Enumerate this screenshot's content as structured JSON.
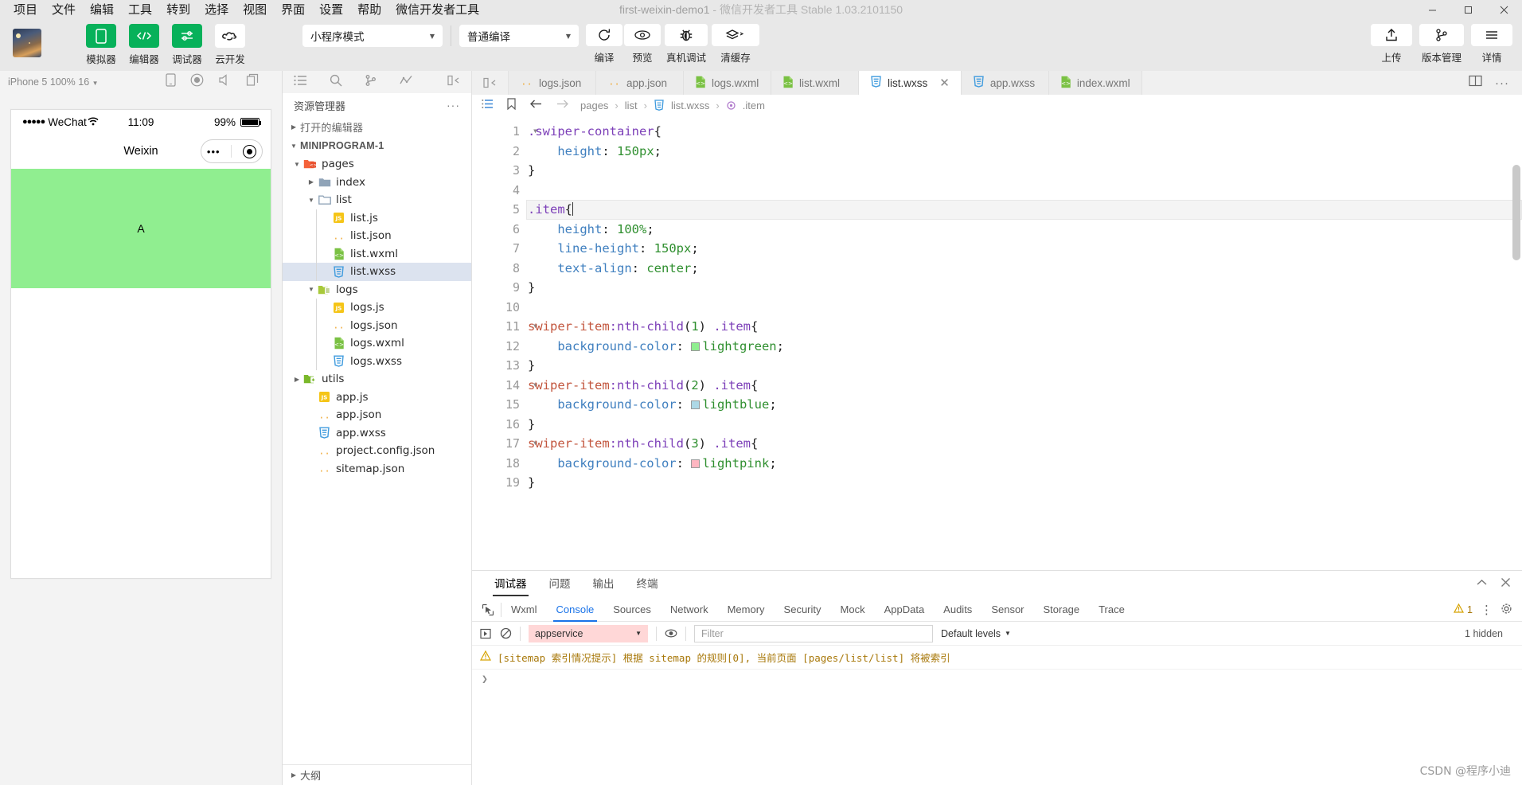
{
  "window": {
    "title_main": "first-weixin-demo1",
    "title_dash": "-",
    "title_sub": "微信开发者工具 Stable 1.03.2101150",
    "minimize": "─",
    "maximize": "□",
    "close": "✕"
  },
  "menubar": {
    "items": [
      "项目",
      "文件",
      "编辑",
      "工具",
      "转到",
      "选择",
      "视图",
      "界面",
      "设置",
      "帮助",
      "微信开发者工具"
    ]
  },
  "toolbar": {
    "mode_buttons": [
      {
        "label": "模拟器",
        "icon": "phone-icon"
      },
      {
        "label": "编辑器",
        "icon": "code-icon"
      },
      {
        "label": "调试器",
        "icon": "sliders-icon"
      },
      {
        "label": "云开发",
        "icon": "cloud-icon"
      }
    ],
    "mode_select": "小程序模式",
    "compile_select": "普通编译",
    "actions": [
      {
        "label": "编译",
        "icon": "refresh-icon"
      },
      {
        "label": "预览",
        "icon": "eye-icon"
      },
      {
        "label": "真机调试",
        "icon": "bug-icon"
      },
      {
        "label": "清缓存",
        "icon": "layers-icon"
      }
    ],
    "right_actions": [
      {
        "label": "上传",
        "icon": "upload-icon"
      },
      {
        "label": "版本管理",
        "icon": "git-branch-icon"
      },
      {
        "label": "详情",
        "icon": "hamburger-icon"
      }
    ]
  },
  "simulator": {
    "device_label": "iPhone 5 100% 16",
    "toolbar_icons": [
      "phone-outline-icon",
      "record-icon",
      "volume-icon",
      "copy-icon"
    ],
    "status": {
      "signal_dots": "●●●●●",
      "carrier": "WeChat",
      "wifi": "wifi-icon",
      "time": "11:09",
      "battery_pct": "99%"
    },
    "nav_title": "Weixin",
    "capsule_dots": "•••",
    "swiper_item_text": "A",
    "swiper_bg": "#90ee90"
  },
  "explorer": {
    "icons": [
      "list-icon",
      "search-icon",
      "git-icon",
      "graph-icon",
      "collapse-icon"
    ],
    "header": "资源管理器",
    "more": "···",
    "open_editors": "打开的编辑器",
    "project_name": "MINIPROGRAM-1",
    "outline": "大纲",
    "tree": [
      {
        "label": "pages",
        "indent": 1,
        "type": "folder-pages",
        "expanded": true,
        "arrow": "▾"
      },
      {
        "label": "index",
        "indent": 2,
        "type": "folder",
        "expanded": false,
        "arrow": "▸"
      },
      {
        "label": "list",
        "indent": 2,
        "type": "folder-open",
        "expanded": true,
        "arrow": "▾"
      },
      {
        "label": "list.js",
        "indent": 3,
        "type": "js",
        "arrow": ""
      },
      {
        "label": "list.json",
        "indent": 3,
        "type": "json",
        "arrow": ""
      },
      {
        "label": "list.wxml",
        "indent": 3,
        "type": "wxml",
        "arrow": ""
      },
      {
        "label": "list.wxss",
        "indent": 3,
        "type": "wxss",
        "arrow": "",
        "selected": true
      },
      {
        "label": "logs",
        "indent": 2,
        "type": "folder-logs",
        "expanded": true,
        "arrow": "▾"
      },
      {
        "label": "logs.js",
        "indent": 3,
        "type": "js",
        "arrow": ""
      },
      {
        "label": "logs.json",
        "indent": 3,
        "type": "json",
        "arrow": ""
      },
      {
        "label": "logs.wxml",
        "indent": 3,
        "type": "wxml",
        "arrow": ""
      },
      {
        "label": "logs.wxss",
        "indent": 3,
        "type": "wxss",
        "arrow": ""
      },
      {
        "label": "utils",
        "indent": 1,
        "type": "folder-utils",
        "expanded": false,
        "arrow": "▸"
      },
      {
        "label": "app.js",
        "indent": 2,
        "type": "js",
        "arrow": ""
      },
      {
        "label": "app.json",
        "indent": 2,
        "type": "json",
        "arrow": ""
      },
      {
        "label": "app.wxss",
        "indent": 2,
        "type": "wxss",
        "arrow": ""
      },
      {
        "label": "project.config.json",
        "indent": 2,
        "type": "json",
        "arrow": ""
      },
      {
        "label": "sitemap.json",
        "indent": 2,
        "type": "json",
        "arrow": ""
      }
    ]
  },
  "editor": {
    "tabs": [
      {
        "label": "logs.json",
        "type": "json",
        "active": false
      },
      {
        "label": "app.json",
        "type": "json",
        "active": false
      },
      {
        "label": "logs.wxml",
        "type": "wxml",
        "active": false
      },
      {
        "label": "list.wxml",
        "type": "wxml",
        "active": false
      },
      {
        "label": "list.wxss",
        "type": "wxss",
        "active": true,
        "close": "✕"
      },
      {
        "label": "app.wxss",
        "type": "wxss",
        "active": false
      },
      {
        "label": "index.wxml",
        "type": "wxml",
        "active": false
      }
    ],
    "tabs_right_icons": [
      "split-editor-icon",
      "more-icon"
    ],
    "breadcrumb": {
      "icons": [
        "outline-icon",
        "bookmark-icon",
        "back-arrow-icon",
        "forward-arrow-icon"
      ],
      "parts": [
        "pages",
        "list",
        "list.wxss",
        ".item"
      ],
      "sep": "›",
      "file_icon": "wxss-icon",
      "symbol_icon": "css-rule-icon"
    },
    "line_numbers": [
      "1",
      "2",
      "3",
      "4",
      "5",
      "6",
      "7",
      "8",
      "9",
      "10",
      "11",
      "12",
      "13",
      "14",
      "15",
      "16",
      "17",
      "18",
      "19"
    ],
    "fold_lines": [
      1,
      5,
      11,
      14,
      17
    ],
    "highlight_line": 5,
    "code_lines": [
      {
        "n": 1,
        "tokens": [
          {
            "t": ".swiper-container",
            "c": "sel-cls"
          },
          {
            "t": "{",
            "c": "brace"
          }
        ]
      },
      {
        "n": 2,
        "tokens": [
          {
            "t": "    ",
            "c": ""
          },
          {
            "t": "height",
            "c": "prop"
          },
          {
            "t": ": ",
            "c": "brace"
          },
          {
            "t": "150px",
            "c": "val"
          },
          {
            "t": ";",
            "c": "brace"
          }
        ]
      },
      {
        "n": 3,
        "tokens": [
          {
            "t": "}",
            "c": "brace"
          }
        ]
      },
      {
        "n": 4,
        "tokens": []
      },
      {
        "n": 5,
        "tokens": [
          {
            "t": ".item",
            "c": "sel-cls"
          },
          {
            "t": "{",
            "c": "brace"
          }
        ],
        "cursor": true
      },
      {
        "n": 6,
        "tokens": [
          {
            "t": "    ",
            "c": ""
          },
          {
            "t": "height",
            "c": "prop"
          },
          {
            "t": ": ",
            "c": "brace"
          },
          {
            "t": "100%",
            "c": "val"
          },
          {
            "t": ";",
            "c": "brace"
          }
        ]
      },
      {
        "n": 7,
        "tokens": [
          {
            "t": "    ",
            "c": ""
          },
          {
            "t": "line-height",
            "c": "prop"
          },
          {
            "t": ": ",
            "c": "brace"
          },
          {
            "t": "150px",
            "c": "val"
          },
          {
            "t": ";",
            "c": "brace"
          }
        ]
      },
      {
        "n": 8,
        "tokens": [
          {
            "t": "    ",
            "c": ""
          },
          {
            "t": "text-align",
            "c": "prop"
          },
          {
            "t": ": ",
            "c": "brace"
          },
          {
            "t": "center",
            "c": "val"
          },
          {
            "t": ";",
            "c": "brace"
          }
        ]
      },
      {
        "n": 9,
        "tokens": [
          {
            "t": "}",
            "c": "brace"
          }
        ]
      },
      {
        "n": 10,
        "tokens": []
      },
      {
        "n": 11,
        "tokens": [
          {
            "t": "swiper-item",
            "c": "tagname"
          },
          {
            "t": ":nth-child",
            "c": "sel-cls"
          },
          {
            "t": "(",
            "c": "brace"
          },
          {
            "t": "1",
            "c": "val"
          },
          {
            "t": ") ",
            "c": "brace"
          },
          {
            "t": ".item",
            "c": "sel-cls"
          },
          {
            "t": "{",
            "c": "brace"
          }
        ]
      },
      {
        "n": 12,
        "tokens": [
          {
            "t": "    ",
            "c": ""
          },
          {
            "t": "background-color",
            "c": "prop"
          },
          {
            "t": ": ",
            "c": "brace"
          },
          {
            "t": "lightgreen",
            "c": "val",
            "swatch": "#90ee90"
          },
          {
            "t": ";",
            "c": "brace"
          }
        ]
      },
      {
        "n": 13,
        "tokens": [
          {
            "t": "}",
            "c": "brace"
          }
        ]
      },
      {
        "n": 14,
        "tokens": [
          {
            "t": "swiper-item",
            "c": "tagname"
          },
          {
            "t": ":nth-child",
            "c": "sel-cls"
          },
          {
            "t": "(",
            "c": "brace"
          },
          {
            "t": "2",
            "c": "val"
          },
          {
            "t": ") ",
            "c": "brace"
          },
          {
            "t": ".item",
            "c": "sel-cls"
          },
          {
            "t": "{",
            "c": "brace"
          }
        ]
      },
      {
        "n": 15,
        "tokens": [
          {
            "t": "    ",
            "c": ""
          },
          {
            "t": "background-color",
            "c": "prop"
          },
          {
            "t": ": ",
            "c": "brace"
          },
          {
            "t": "lightblue",
            "c": "val",
            "swatch": "#add8e6"
          },
          {
            "t": ";",
            "c": "brace"
          }
        ]
      },
      {
        "n": 16,
        "tokens": [
          {
            "t": "}",
            "c": "brace"
          }
        ]
      },
      {
        "n": 17,
        "tokens": [
          {
            "t": "swiper-item",
            "c": "tagname"
          },
          {
            "t": ":nth-child",
            "c": "sel-cls"
          },
          {
            "t": "(",
            "c": "brace"
          },
          {
            "t": "3",
            "c": "val"
          },
          {
            "t": ") ",
            "c": "brace"
          },
          {
            "t": ".item",
            "c": "sel-cls"
          },
          {
            "t": "{",
            "c": "brace"
          }
        ]
      },
      {
        "n": 18,
        "tokens": [
          {
            "t": "    ",
            "c": ""
          },
          {
            "t": "background-color",
            "c": "prop"
          },
          {
            "t": ": ",
            "c": "brace"
          },
          {
            "t": "lightpink",
            "c": "val",
            "swatch": "#ffb6c1"
          },
          {
            "t": ";",
            "c": "brace"
          }
        ]
      },
      {
        "n": 19,
        "tokens": [
          {
            "t": "}",
            "c": "brace"
          }
        ]
      }
    ]
  },
  "devtools": {
    "panel_tabs": [
      "调试器",
      "问题",
      "输出",
      "终端"
    ],
    "panel_active": "调试器",
    "panel_controls": [
      "collapse-icon",
      "close-icon"
    ],
    "inspect_icon": "inspect-cursor-icon",
    "tabs": [
      "Wxml",
      "Console",
      "Sources",
      "Network",
      "Memory",
      "Security",
      "Mock",
      "AppData",
      "Audits",
      "Sensor",
      "Storage",
      "Trace"
    ],
    "active_tab": "Console",
    "warning_count": "1",
    "more_icon": "⋮",
    "settings_icon": "gear-icon",
    "filter_row": {
      "execute_icon": "step-icon",
      "clear_icon": "clear-icon",
      "context": "appservice",
      "eye_icon": "eye-icon",
      "filter_placeholder": "Filter",
      "levels": "Default levels",
      "hidden": "1 hidden"
    },
    "messages": [
      {
        "icon": "warning-icon",
        "text": "[sitemap 索引情况提示] 根据 sitemap 的规则[0], 当前页面 [pages/list/list] 将被索引"
      }
    ],
    "prompt": "❯"
  },
  "watermark": "CSDN @程序小迪"
}
